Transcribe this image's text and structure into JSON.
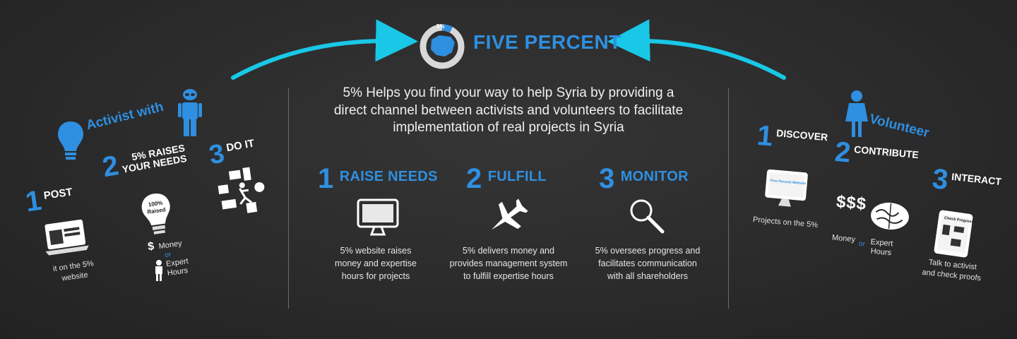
{
  "header": {
    "title": "FIVE PERCENT",
    "logo_label": "5%"
  },
  "intro": {
    "line1": "5% Helps you find your way to help Syria by providing a",
    "line2": "direct channel between activists and volunteers to facilitate",
    "line3": "implementation of real projects in Syria"
  },
  "center_steps": [
    {
      "number": "1",
      "title": "RAISE NEEDS",
      "icon": "monitor-icon",
      "desc1": "5% website raises",
      "desc2": "money and expertise",
      "desc3": "hours for projects"
    },
    {
      "number": "2",
      "title": "FULFILL",
      "icon": "airplane-icon",
      "desc1": "5% delivers money and",
      "desc2": "provides management system",
      "desc3": "to fulfill expertise hours"
    },
    {
      "number": "3",
      "title": "MONITOR",
      "icon": "magnifier-icon",
      "desc1": "5% oversees progress and",
      "desc2": "facilitates communication",
      "desc3": "with all shareholders"
    }
  ],
  "activist": {
    "title": "Activist with",
    "steps": [
      {
        "number": "1",
        "title": "POST",
        "caption1": "it on the 5%",
        "caption2": "website"
      },
      {
        "number": "2",
        "title1": "5% RAISES",
        "title2": "YOUR NEEDS",
        "bulb_text1": "100%",
        "bulb_text2": "Raised",
        "money_symbol": "$",
        "money": "Money",
        "or": "or",
        "expert1": "Expert",
        "expert2": "Hours"
      },
      {
        "number": "3",
        "title": "DO IT"
      }
    ]
  },
  "volunteer": {
    "title": "Volunteer",
    "steps": [
      {
        "number": "1",
        "title": "DISCOVER",
        "screen_text": "Five Percent Website",
        "caption": "Projects on the 5%"
      },
      {
        "number": "2",
        "title": "CONTRIBUTE",
        "money_symbol": "$$$",
        "money": "Money",
        "or": "or",
        "expert1": "Expert",
        "expert2": "Hours"
      },
      {
        "number": "3",
        "title": "INTERACT",
        "tablet_text": "Check Progress",
        "caption1": "Talk to activist",
        "caption2": "and check proofs"
      }
    ]
  },
  "colors": {
    "accent_blue": "#2f8fe0",
    "arrow_cyan": "#19c8e6",
    "background": "#2a2a2b"
  }
}
